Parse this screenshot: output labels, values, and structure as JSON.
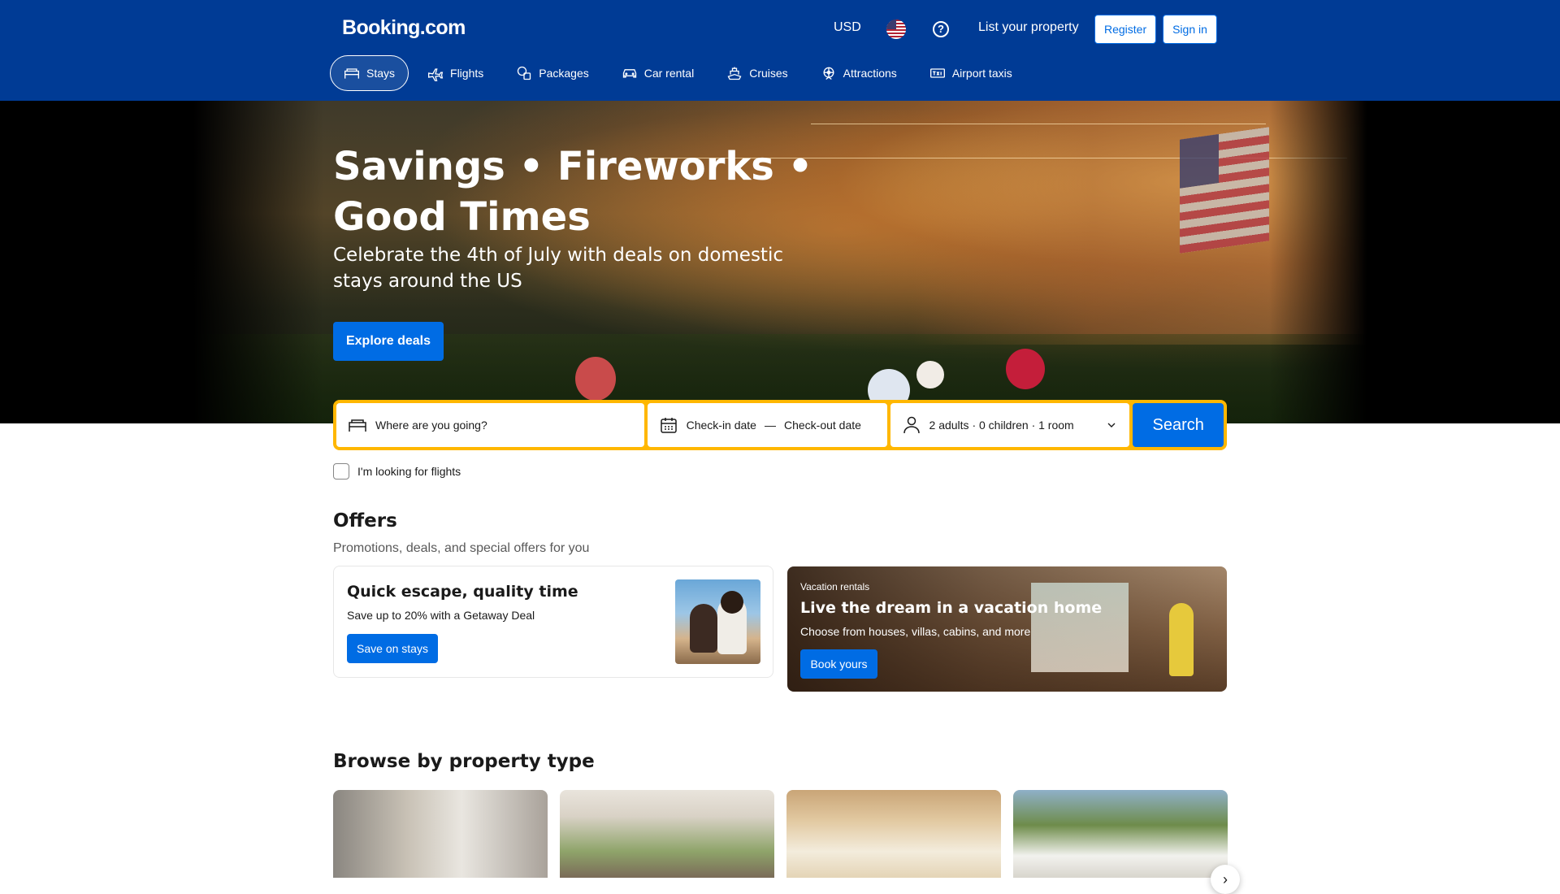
{
  "header": {
    "logo": "Booking.com",
    "currency": "USD",
    "help_icon": "question-icon",
    "list_property": "List your property",
    "register": "Register",
    "sign_in": "Sign in"
  },
  "nav": {
    "items": [
      {
        "label": "Stays",
        "icon": "bed-icon",
        "active": true
      },
      {
        "label": "Flights",
        "icon": "plane-icon"
      },
      {
        "label": "Packages",
        "icon": "packages-icon"
      },
      {
        "label": "Car rental",
        "icon": "car-icon"
      },
      {
        "label": "Cruises",
        "icon": "ship-icon"
      },
      {
        "label": "Attractions",
        "icon": "attractions-icon"
      },
      {
        "label": "Airport taxis",
        "icon": "taxi-icon"
      }
    ]
  },
  "hero": {
    "title": "Savings • Fireworks • Good Times",
    "subtitle": "Celebrate the 4th of July with deals on domestic stays around the US",
    "cta": "Explore deals"
  },
  "search": {
    "destination_placeholder": "Where are you going?",
    "checkin": "Check-in date",
    "date_separator": "—",
    "checkout": "Check-out date",
    "guests": "2 adults · 0 children · 1 room",
    "button": "Search",
    "flights_checkbox": "I'm looking for flights"
  },
  "offers": {
    "title": "Offers",
    "subtitle": "Promotions, deals, and special offers for you",
    "cards": [
      {
        "title": "Quick escape, quality time",
        "description": "Save up to 20% with a Getaway Deal",
        "button": "Save on stays"
      },
      {
        "kicker": "Vacation rentals",
        "title": "Live the dream in a vacation home",
        "description": "Choose from houses, villas, cabins, and more",
        "button": "Book yours"
      }
    ]
  },
  "browse": {
    "title": "Browse by property type",
    "next_icon": "chevron-right-icon"
  },
  "colors": {
    "brand_blue": "#003b95",
    "action_blue": "#006ce4",
    "search_border": "#ffb700"
  }
}
